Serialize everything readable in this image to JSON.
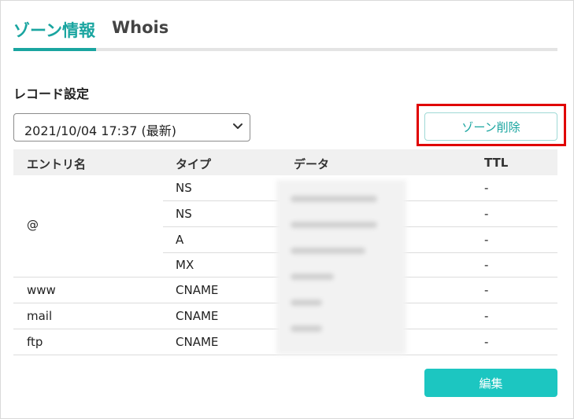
{
  "tabs": {
    "zone_info": "ゾーン情報",
    "whois": "Whois"
  },
  "section": {
    "title": "レコード設定"
  },
  "record_select": {
    "value": "2021/10/04 17:37 (最新)"
  },
  "buttons": {
    "delete_zone": "ゾーン削除",
    "edit": "編集"
  },
  "table": {
    "headers": {
      "name": "エントリ名",
      "type": "タイプ",
      "data": "データ",
      "ttl": "TTL"
    },
    "group_at": {
      "name": "@",
      "rows": [
        {
          "type": "NS",
          "ttl": "-"
        },
        {
          "type": "NS",
          "ttl": "-"
        },
        {
          "type": "A",
          "ttl": "-"
        },
        {
          "type": "MX",
          "ttl": "-"
        }
      ]
    },
    "rows": [
      {
        "name": "www",
        "type": "CNAME",
        "ttl": "-"
      },
      {
        "name": "mail",
        "type": "CNAME",
        "ttl": "-"
      },
      {
        "name": "ftp",
        "type": "CNAME",
        "ttl": "-"
      }
    ]
  },
  "colors": {
    "accent": "#1aa5a0",
    "edit_button": "#1cc6c1",
    "highlight": "#e00000"
  },
  "icons": {
    "select_chevron": "chevron-down-icon"
  }
}
